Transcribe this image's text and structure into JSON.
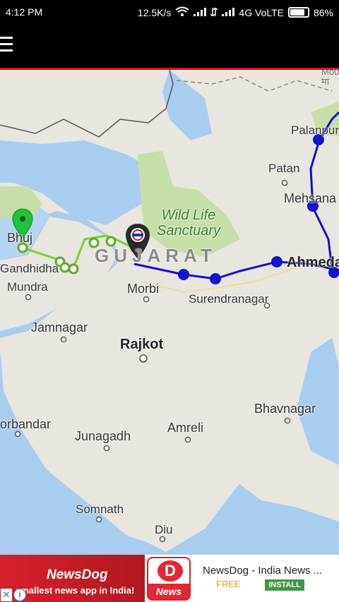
{
  "status_bar": {
    "time": "4:12 PM",
    "speed": "12.5K/s",
    "network": "4G VoLTE",
    "battery": "86%"
  },
  "toolbar": {
    "menu_icon": "hamburger-menu-icon"
  },
  "map": {
    "state_label": "GUJARAT",
    "park_label_line1": "Wild Life",
    "park_label_line2": "Sanctuary",
    "cities": {
      "bhuj": "Bhuj",
      "gandhidham": "Gandhidham",
      "mundra": "Mundra",
      "morbi": "Morbi",
      "surendranagar": "Surendranagar",
      "jamnagar": "Jamnagar",
      "rajkot": "Rajkot",
      "bhavnagar": "Bhavnagar",
      "porbandar": "Porbandar",
      "junagadh": "Junagadh",
      "amreli": "Amreli",
      "somnath": "Somnath",
      "diu": "Diu",
      "palanpur": "Palanpur",
      "patan": "Patan",
      "mehsana": "Mehsana",
      "ahmedabad": "Ahmedabad",
      "top_right_fragment": "Mou\nमा"
    },
    "colors": {
      "land": "#e9e5df",
      "water": "#a9cdef",
      "park": "#c6dfa9",
      "green_route": "#7bd034",
      "blue_route": "#1010cc"
    }
  },
  "ad": {
    "banner_title": "NewsDog",
    "banner_sub": "smallest news app in India!",
    "logo_word": "News",
    "logo_glyph": "D",
    "app_name": "NewsDog - India News ...",
    "price": "FREE",
    "install_label": "INSTALL",
    "close_icon": "close-icon",
    "info_icon": "info-icon"
  }
}
